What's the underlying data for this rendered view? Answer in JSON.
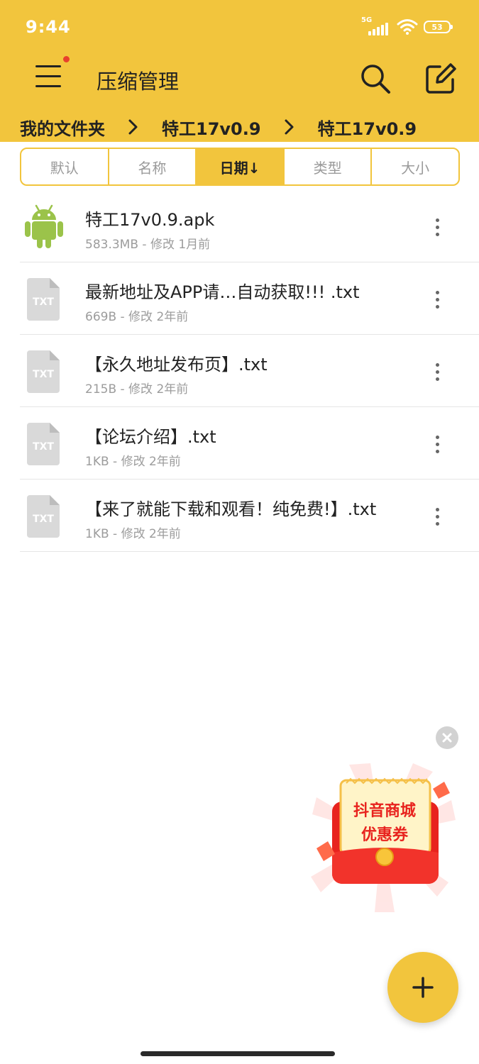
{
  "status_bar": {
    "time": "9:44",
    "network": "5G",
    "battery": "53",
    "signal_icon": "cellular-signal-icon",
    "wifi_icon": "wifi-icon"
  },
  "header": {
    "title": "压缩管理",
    "menu_icon": "hamburger-menu-icon",
    "search_icon": "search-icon",
    "edit_icon": "edit-icon",
    "accent_color": "#f2c53d",
    "notification_dot_color": "#e8402c"
  },
  "breadcrumb": {
    "items": [
      "我的文件夹",
      "特工17v0.9",
      "特工17v0.9"
    ],
    "separator_icon": "chevron-right-icon"
  },
  "sort_tabs": [
    {
      "label": "默认",
      "active": false
    },
    {
      "label": "名称",
      "active": false
    },
    {
      "label": "日期↓",
      "active": true
    },
    {
      "label": "类型",
      "active": false
    },
    {
      "label": "大小",
      "active": false
    }
  ],
  "files": [
    {
      "name": "特工17v0.9.apk",
      "meta": "583.3MB - 修改 1月前",
      "icon": "android-apk-icon"
    },
    {
      "name": "最新地址及APP请…自动获取!!! .txt",
      "meta": "669B - 修改 2年前",
      "icon": "txt-file-icon"
    },
    {
      "name": "【永久地址发布页】.txt",
      "meta": "215B - 修改 2年前",
      "icon": "txt-file-icon"
    },
    {
      "name": "【论坛介绍】.txt",
      "meta": "1KB - 修改 2年前",
      "icon": "txt-file-icon"
    },
    {
      "name": "【来了就能下载和观看！纯免费!】.txt",
      "meta": "1KB - 修改 2年前",
      "icon": "txt-file-icon"
    }
  ],
  "file_icon_label": "TXT",
  "promo": {
    "line1": "抖音商城",
    "line2": "优惠券",
    "close_icon": "close-icon"
  },
  "fab": {
    "icon": "plus-icon"
  }
}
